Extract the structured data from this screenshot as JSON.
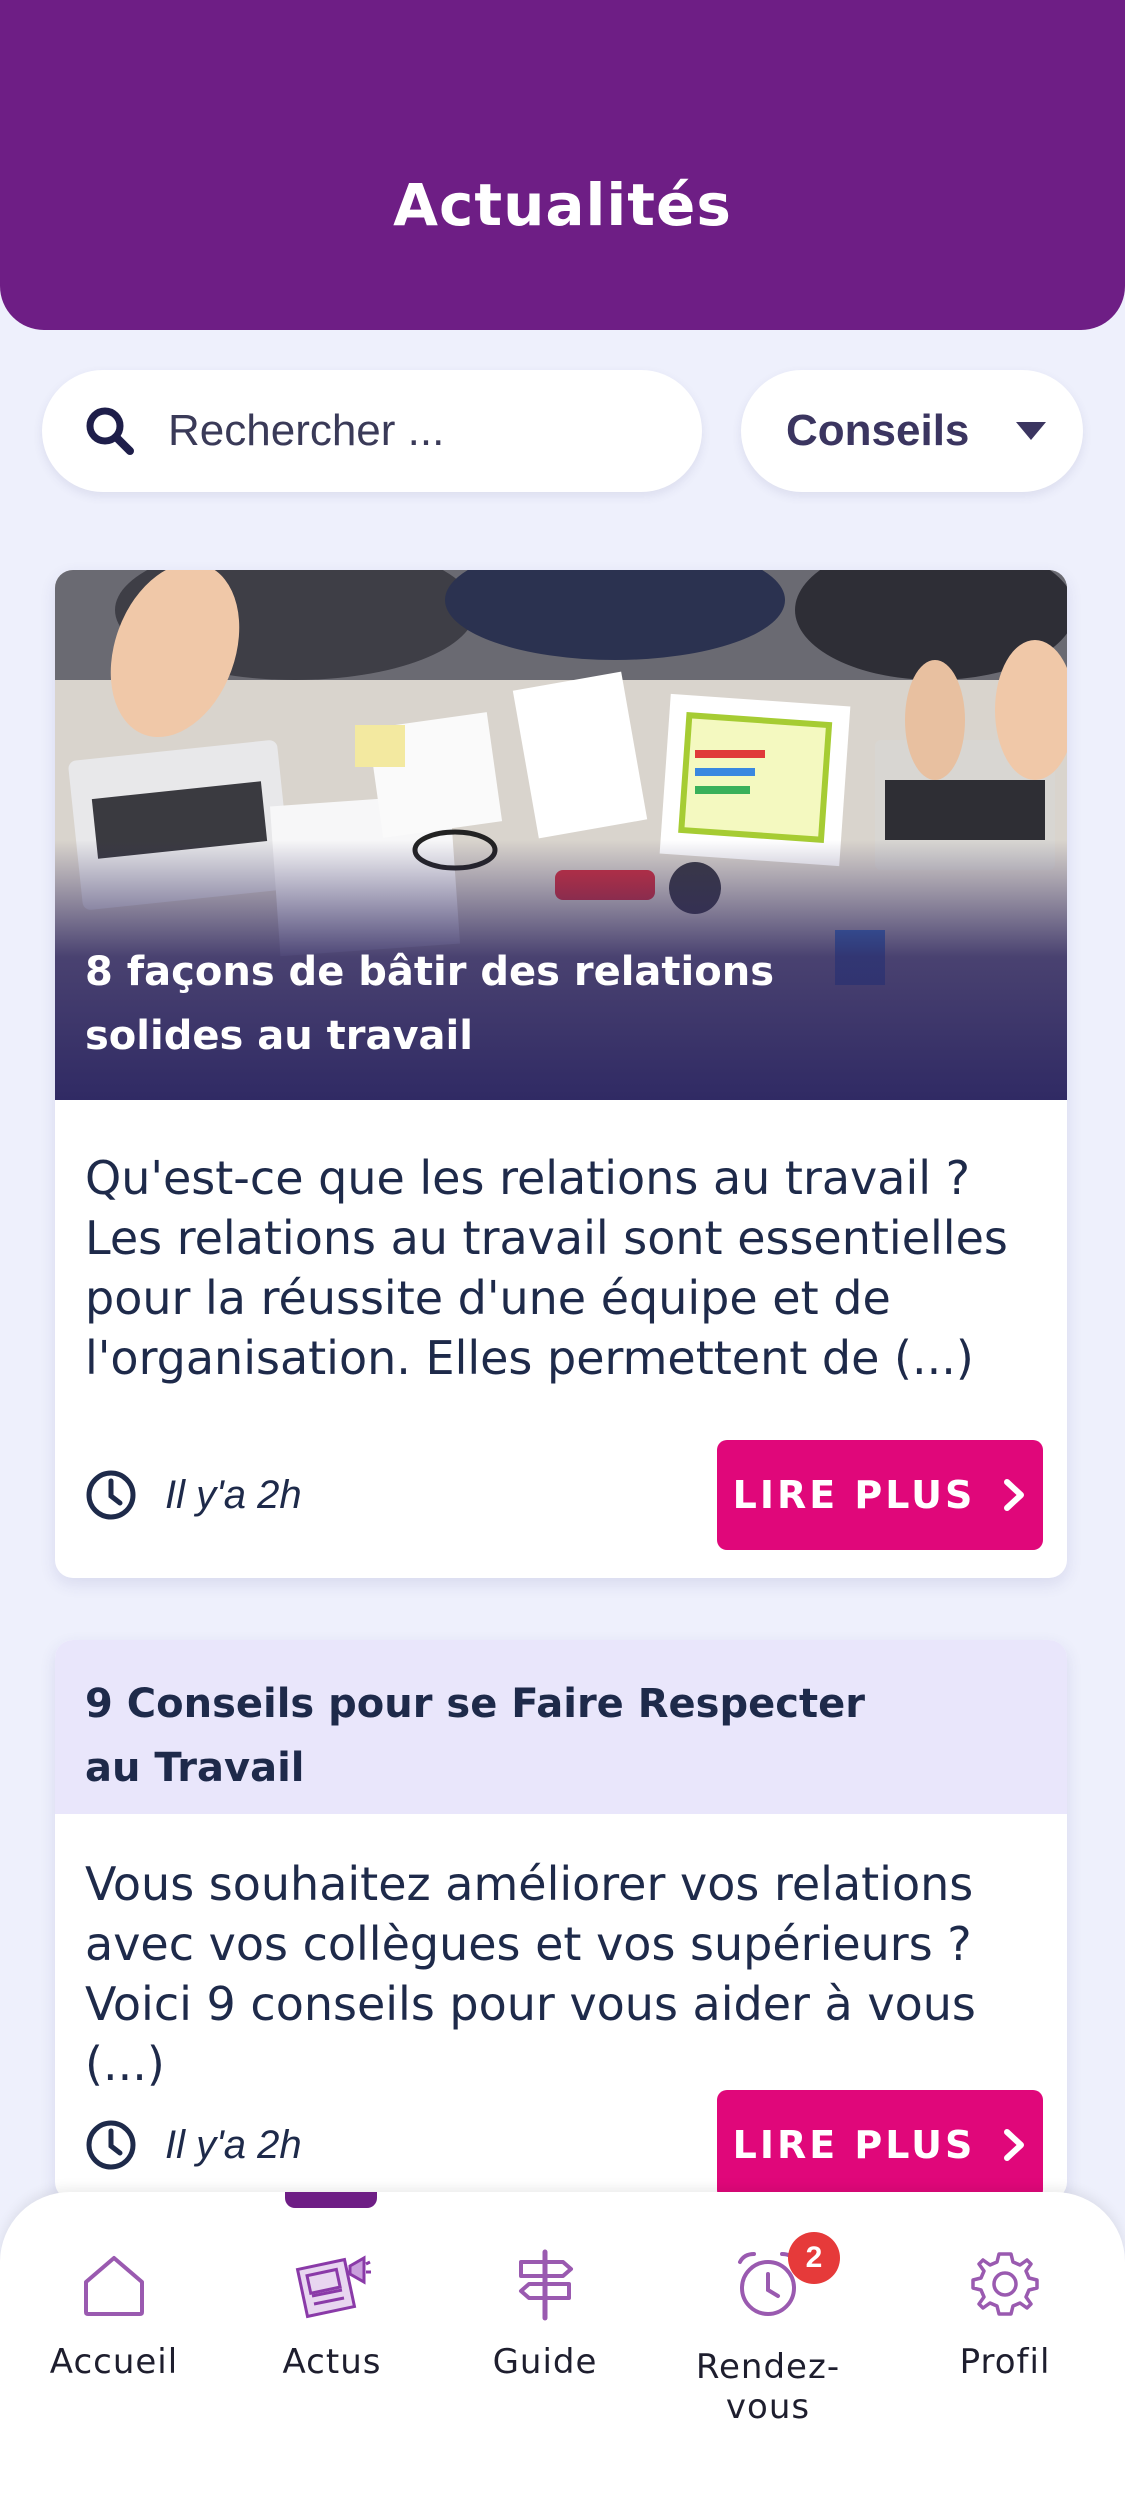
{
  "header": {
    "title": "Actualités"
  },
  "search": {
    "placeholder": "Rechercher ..."
  },
  "filter": {
    "selected": "Conseils"
  },
  "articles": [
    {
      "title": "8 façons de bâtir des relations solides au travail",
      "excerpt": "Qu'est-ce que les relations au travail ? Les relations au travail sont essentielles pour la réussite d'une équipe et de l'organisation. Elles permettent de (...)",
      "time": "Il y'a 2h",
      "button": "LIRE PLUS"
    },
    {
      "title": "9 Conseils pour se Faire Respecter au Travail",
      "excerpt": "Vous souhaitez améliorer vos relations avec vos collègues et vos supérieurs ? Voici 9 conseils pour vous aider à vous (...)",
      "time": "Il y'a 2h",
      "button": "LIRE PLUS"
    }
  ],
  "tabbar": {
    "items": [
      {
        "label": "Accueil",
        "icon": "home-icon"
      },
      {
        "label": "Actus",
        "icon": "newspaper-icon",
        "active": true
      },
      {
        "label": "Guide",
        "icon": "signpost-icon"
      },
      {
        "label": "Rendez-vous",
        "icon": "alarm-clock-icon",
        "badge": "2"
      },
      {
        "label": "Profil",
        "icon": "gear-icon"
      }
    ]
  },
  "colors": {
    "primary": "#6e1e85",
    "accent": "#e0077a",
    "background": "#eef0fc",
    "text": "#1e2a4a"
  }
}
